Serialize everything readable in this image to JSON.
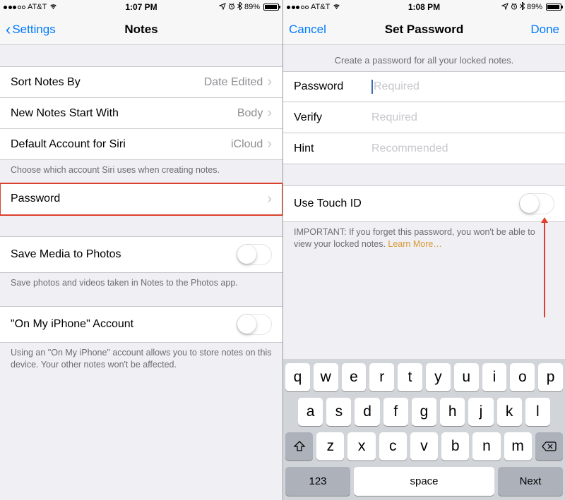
{
  "left": {
    "status": {
      "carrier": "AT&T",
      "time": "1:07 PM",
      "battery": "89%"
    },
    "nav": {
      "back": "Settings",
      "title": "Notes"
    },
    "rows": {
      "sort": {
        "label": "Sort Notes By",
        "value": "Date Edited"
      },
      "newnotes": {
        "label": "New Notes Start With",
        "value": "Body"
      },
      "siri": {
        "label": "Default Account for Siri",
        "value": "iCloud"
      },
      "password": {
        "label": "Password"
      },
      "savemedia": {
        "label": "Save Media to Photos"
      },
      "onmyiphone": {
        "label": "\"On My iPhone\" Account"
      }
    },
    "footers": {
      "siri": "Choose which account Siri uses when creating notes.",
      "savemedia": "Save photos and videos taken in Notes to the Photos app.",
      "onmyiphone": "Using an \"On My iPhone\" account allows you to store notes on this device. Your other notes won't be affected."
    }
  },
  "right": {
    "status": {
      "carrier": "AT&T",
      "time": "1:08 PM",
      "battery": "89%"
    },
    "nav": {
      "cancel": "Cancel",
      "title": "Set Password",
      "done": "Done"
    },
    "header": "Create a password for all your locked notes.",
    "fields": {
      "password": {
        "label": "Password",
        "placeholder": "Required"
      },
      "verify": {
        "label": "Verify",
        "placeholder": "Required"
      },
      "hint": {
        "label": "Hint",
        "placeholder": "Recommended"
      }
    },
    "touchid": {
      "label": "Use Touch ID"
    },
    "important": "IMPORTANT: If you forget this password, you won't be able to view your locked notes. ",
    "learnmore": "Learn More…"
  },
  "keyboard": {
    "row1": [
      "q",
      "w",
      "e",
      "r",
      "t",
      "y",
      "u",
      "i",
      "o",
      "p"
    ],
    "row2": [
      "a",
      "s",
      "d",
      "f",
      "g",
      "h",
      "j",
      "k",
      "l"
    ],
    "row3": [
      "z",
      "x",
      "c",
      "v",
      "b",
      "n",
      "m"
    ],
    "num": "123",
    "space": "space",
    "next": "Next"
  }
}
